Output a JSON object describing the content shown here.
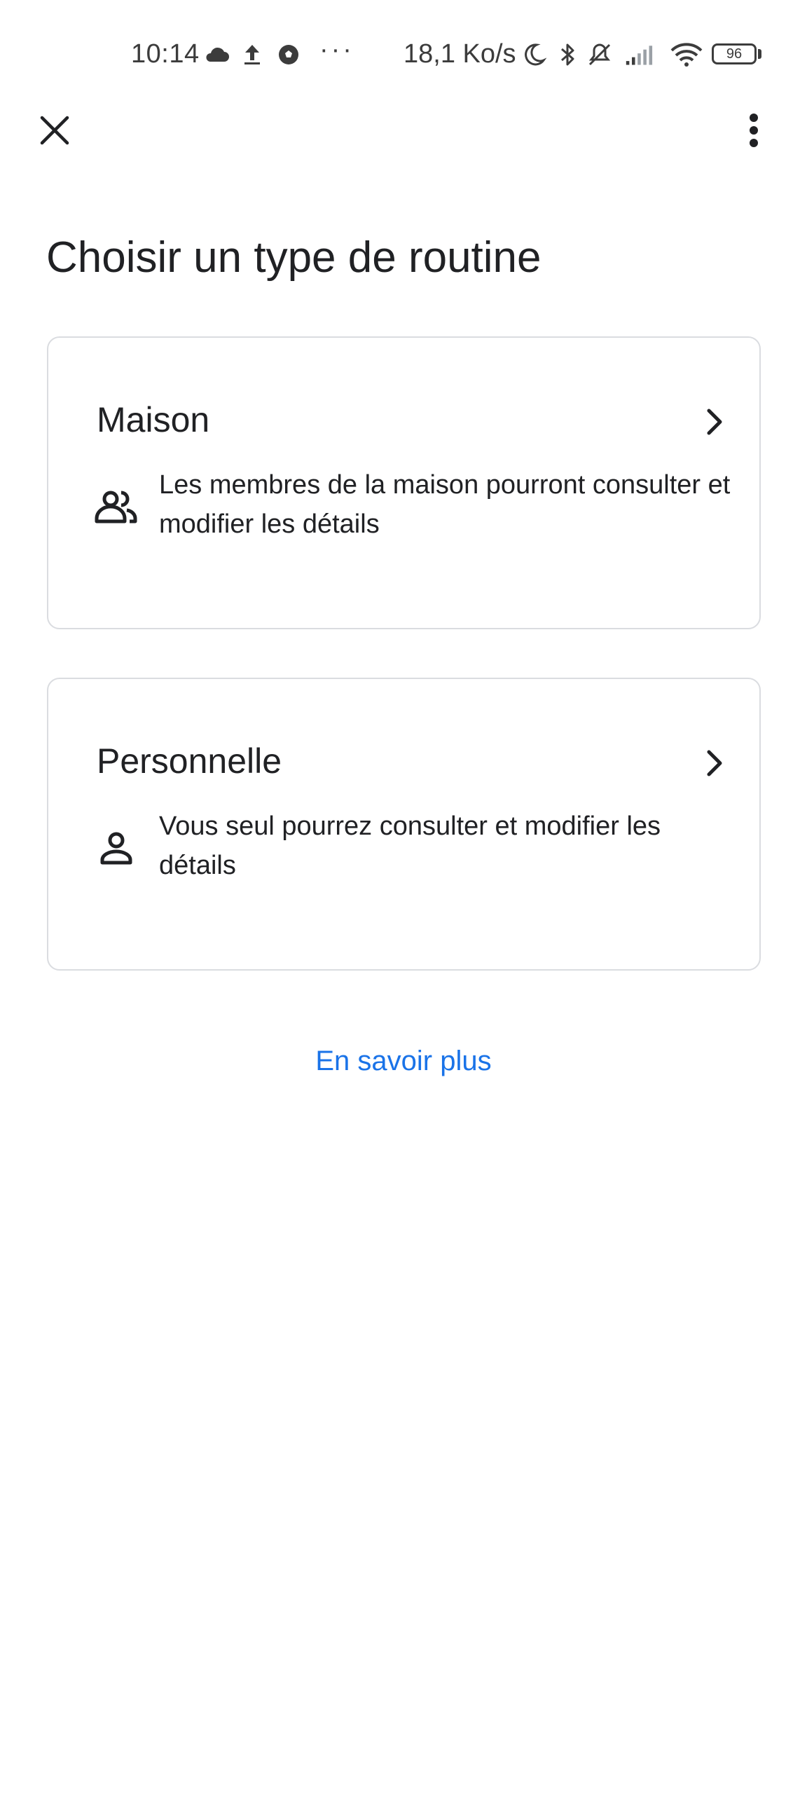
{
  "status_bar": {
    "time": "10:14",
    "overflow": "···",
    "network_speed": "18,1 Ko/s",
    "battery": "96",
    "icons": [
      "cloud-icon",
      "upload-icon",
      "soccer-ball-icon",
      "moon-icon",
      "bluetooth-icon",
      "muted-bell-icon",
      "signal-icon",
      "wifi-icon",
      "battery-icon"
    ]
  },
  "app_bar": {
    "close_icon": "close-icon",
    "menu_icon": "more-vert-icon"
  },
  "title": "Choisir un type de routine",
  "cards": [
    {
      "title": "Maison",
      "icon": "people-icon",
      "description": "Les membres de la maison pourront consulter et modifier les détails"
    },
    {
      "title": "Personnelle",
      "icon": "person-icon",
      "description": "Vous seul pourrez consulter et modifier les détails"
    }
  ],
  "learn_more": "En savoir plus",
  "colors": {
    "link": "#1a73e8",
    "text": "#202124",
    "border": "#dadce0"
  }
}
